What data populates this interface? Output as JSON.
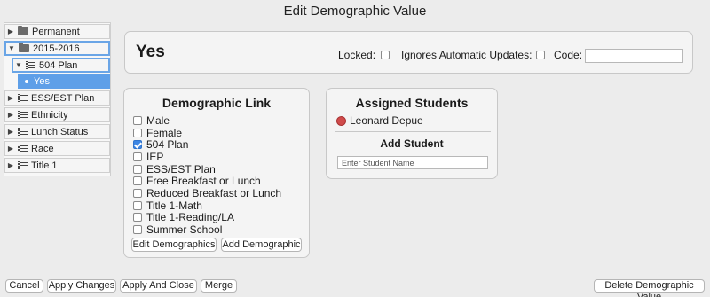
{
  "window": {
    "title": "Edit Demographic Value"
  },
  "tree": {
    "items": [
      {
        "label": "Permanent",
        "icon": "folder-icon",
        "expanded": false
      },
      {
        "label": "2015-2016",
        "icon": "folder-icon",
        "expanded": true
      },
      {
        "label": "504 Plan",
        "icon": "list-icon",
        "expanded": true
      },
      {
        "label": "Yes",
        "icon": "bullet-icon",
        "selected": true
      },
      {
        "label": "ESS/EST Plan",
        "icon": "list-icon",
        "expanded": false
      },
      {
        "label": "Ethnicity",
        "icon": "list-icon",
        "expanded": false
      },
      {
        "label": "Lunch Status",
        "icon": "list-icon",
        "expanded": false
      },
      {
        "label": "Race",
        "icon": "list-icon",
        "expanded": false
      },
      {
        "label": "Title 1",
        "icon": "list-icon",
        "expanded": false
      }
    ]
  },
  "header": {
    "value_title": "Yes",
    "locked_label": "Locked:",
    "locked_checked": false,
    "ignores_label": "Ignores Automatic Updates:",
    "ignores_checked": false,
    "code_label": "Code:",
    "code_value": ""
  },
  "demographic_link": {
    "heading": "Demographic Link",
    "items": [
      {
        "label": "Male",
        "checked": false
      },
      {
        "label": "Female",
        "checked": false
      },
      {
        "label": "504 Plan",
        "checked": true
      },
      {
        "label": "IEP",
        "checked": false
      },
      {
        "label": "ESS/EST Plan",
        "checked": false
      },
      {
        "label": "Free Breakfast or Lunch",
        "checked": false
      },
      {
        "label": "Reduced Breakfast or Lunch",
        "checked": false
      },
      {
        "label": "Title 1-Math",
        "checked": false
      },
      {
        "label": "Title 1-Reading/LA",
        "checked": false
      },
      {
        "label": "Summer School",
        "checked": false
      }
    ],
    "edit_button": "Edit Demographics",
    "add_button": "Add Demographic"
  },
  "assigned": {
    "heading": "Assigned Students",
    "students": [
      "Leonard Depue"
    ],
    "add_heading": "Add Student",
    "input_placeholder": "Enter Student Name"
  },
  "footer": {
    "cancel": "Cancel",
    "apply_changes": "Apply Changes",
    "apply_close": "Apply And Close",
    "merge": "Merge",
    "delete": "Delete Demographic Value"
  }
}
